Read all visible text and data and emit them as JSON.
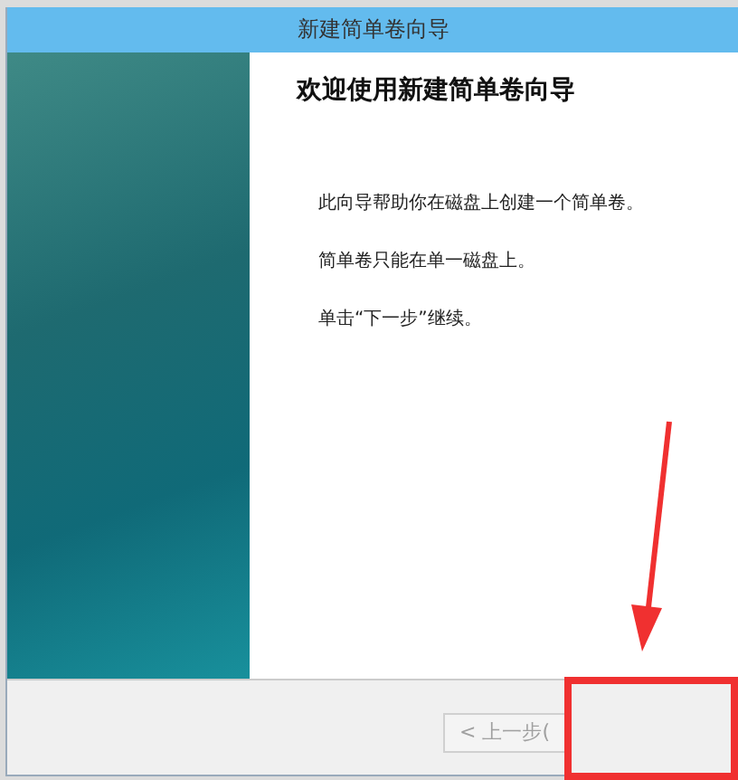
{
  "window": {
    "title": "新建简单卷向导"
  },
  "heading": "欢迎使用新建简单卷向导",
  "paragraphs": [
    "此向导帮助你在磁盘上创建一个简单卷。",
    "简单卷只能在单一磁盘上。",
    "单击“下一步”继续。"
  ],
  "buttons": [
    {
      "label": "< 上一步(",
      "disabled": true
    }
  ]
}
